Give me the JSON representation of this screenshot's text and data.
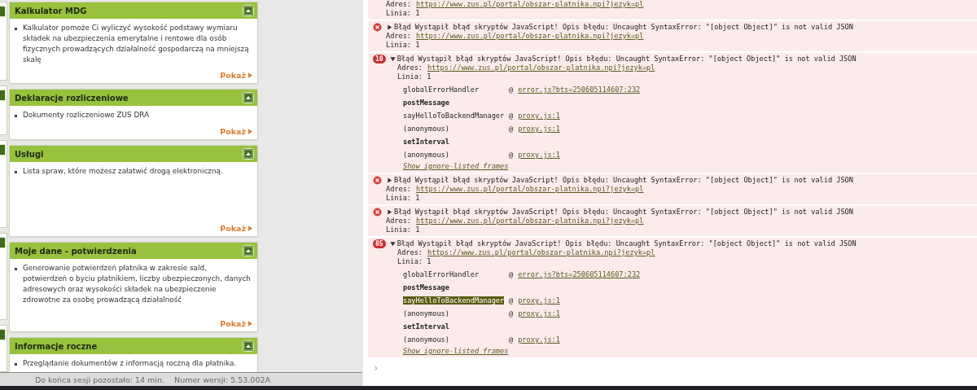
{
  "cards": [
    {
      "title": "Kalkulator MDG",
      "items": [
        "Kalkulator pomoże Ci wyliczyć wysokość podstawy wymiaru składek na ubezpieczenia emerytalne i rentowe dla osób fizycznych prowadzących działalność gospodarczą na mniejszą skalę"
      ],
      "more": "Pokaż"
    },
    {
      "title": "Deklaracje rozliczeniowe",
      "items": [
        "Dokumenty rozliczeniowe ZUS DRA"
      ],
      "more": "Pokaż"
    },
    {
      "title": "Usługi",
      "items": [
        "Lista spraw, które możesz załatwić drogą elektroniczną."
      ],
      "more": "Pokaż"
    },
    {
      "title": "Moje dane - potwierdzenia",
      "items": [
        "Generowanie potwierdzeń płatnika w zakresie sald, potwierdzeń o byciu płatnikiem, liczby ubezpieczonych, danych adresowych oraz wysokości składek na ubezpieczenie zdrowotne za osobę prowadzącą działalność"
      ],
      "more": "Pokaż"
    },
    {
      "title": "Informacje roczne",
      "items": [
        "Przeglądanie dokumentów z informacją roczną dla płatnika."
      ]
    }
  ],
  "status_bar": {
    "session": "Do końca sesji pozostało: 14 min.",
    "version": "Numer wersji: 5.53.002A"
  },
  "console": {
    "entries": [
      {
        "kind": "tail",
        "address_label": "Adres:",
        "address": "https://www.zus.pl/portal/obszar-platnika.npi?jezyk=pl",
        "line": "Linia: 1"
      },
      {
        "kind": "error",
        "expanded": false,
        "message": "Błąd Wystąpił błąd skryptów JavaScript! Opis błędu: Uncaught SyntaxError: \"[object Object]\" is not valid JSON",
        "address_label": "Adres:",
        "address": "https://www.zus.pl/portal/obszar-platnika.npi?jezyk=pl",
        "line": "Linia: 1"
      },
      {
        "kind": "error",
        "count": "10",
        "expanded": true,
        "message": "Błąd Wystąpił błąd skryptów JavaScript! Opis błędu: Uncaught SyntaxError: \"[object Object]\" is not valid JSON",
        "address_label": "Adres:",
        "address": "https://www.zus.pl/portal/obszar-platnika.npi?jezyk=pl",
        "line": "Linia: 1",
        "frames": [
          {
            "kind": "frame",
            "function": "globalErrorHandler",
            "at": "@",
            "source": "error.js?bts=250605114607:232",
            "selected": false
          },
          {
            "kind": "group",
            "label": "postMessage"
          },
          {
            "kind": "frame",
            "function": "sayHelloToBackendManager",
            "at": "@",
            "source": "proxy.js:1",
            "selected": false
          },
          {
            "kind": "frame",
            "function": "(anonymous)",
            "at": "@",
            "source": "proxy.js:1",
            "selected": false
          },
          {
            "kind": "group",
            "label": "setInterval"
          },
          {
            "kind": "frame",
            "function": "(anonymous)",
            "at": "@",
            "source": "proxy.js:1",
            "selected": false
          }
        ],
        "show_ignored": "Show ignore-listed frames"
      },
      {
        "kind": "error",
        "expanded": false,
        "message": "Błąd Wystąpił błąd skryptów JavaScript! Opis błędu: Uncaught SyntaxError: \"[object Object]\" is not valid JSON",
        "address_label": "Adres:",
        "address": "https://www.zus.pl/portal/obszar-platnika.npi?jezyk=pl",
        "line": "Linia: 1"
      },
      {
        "kind": "error",
        "expanded": false,
        "message": "Błąd Wystąpił błąd skryptów JavaScript! Opis błędu: Uncaught SyntaxError: \"[object Object]\" is not valid JSON",
        "address_label": "Adres:",
        "address": "https://www.zus.pl/portal/obszar-platnika.npi?jezyk=pl",
        "line": "Linia: 1"
      },
      {
        "kind": "error",
        "count": "85",
        "expanded": true,
        "message": "Błąd Wystąpił błąd skryptów JavaScript! Opis błędu: Uncaught SyntaxError: \"[object Object]\" is not valid JSON",
        "address_label": "Adres:",
        "address": "https://www.zus.pl/portal/obszar-platnika.npi?jezyk=pl",
        "line": "Linia: 1",
        "frames": [
          {
            "kind": "frame",
            "function": "globalErrorHandler",
            "at": "@",
            "source": "error.js?bts=250605114607:232",
            "selected": false
          },
          {
            "kind": "group",
            "label": "postMessage"
          },
          {
            "kind": "frame",
            "function": "sayHelloToBackendManager",
            "at": "@",
            "source": "proxy.js:1",
            "selected": true
          },
          {
            "kind": "frame",
            "function": "(anonymous)",
            "at": "@",
            "source": "proxy.js:1",
            "selected": false
          },
          {
            "kind": "group",
            "label": "setInterval"
          },
          {
            "kind": "frame",
            "function": "(anonymous)",
            "at": "@",
            "source": "proxy.js:1",
            "selected": false
          }
        ],
        "show_ignored": "Show ignore-listed frames"
      }
    ],
    "prompt": "›"
  }
}
